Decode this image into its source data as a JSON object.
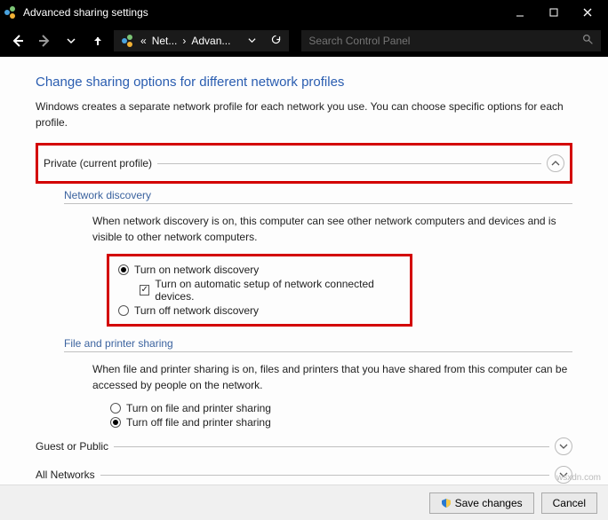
{
  "window": {
    "title": "Advanced sharing settings"
  },
  "breadcrumbs": {
    "prefix": "«",
    "item1": "Net...",
    "item2": "Advan..."
  },
  "search": {
    "placeholder": "Search Control Panel"
  },
  "page": {
    "title": "Change sharing options for different network profiles",
    "desc": "Windows creates a separate network profile for each network you use. You can choose specific options for each profile."
  },
  "sections": {
    "private_label": "Private (current profile)",
    "guest_label": "Guest or Public",
    "all_label": "All Networks"
  },
  "network_discovery": {
    "header": "Network discovery",
    "desc": "When network discovery is on, this computer can see other network computers and devices and is visible to other network computers.",
    "opt_on": "Turn on network discovery",
    "opt_auto": "Turn on automatic setup of network connected devices.",
    "opt_off": "Turn off network discovery"
  },
  "file_printer": {
    "header": "File and printer sharing",
    "desc": "When file and printer sharing is on, files and printers that you have shared from this computer can be accessed by people on the network.",
    "opt_on": "Turn on file and printer sharing",
    "opt_off": "Turn off file and printer sharing"
  },
  "buttons": {
    "save": "Save changes",
    "cancel": "Cancel"
  },
  "watermark": "wsxdn.com"
}
